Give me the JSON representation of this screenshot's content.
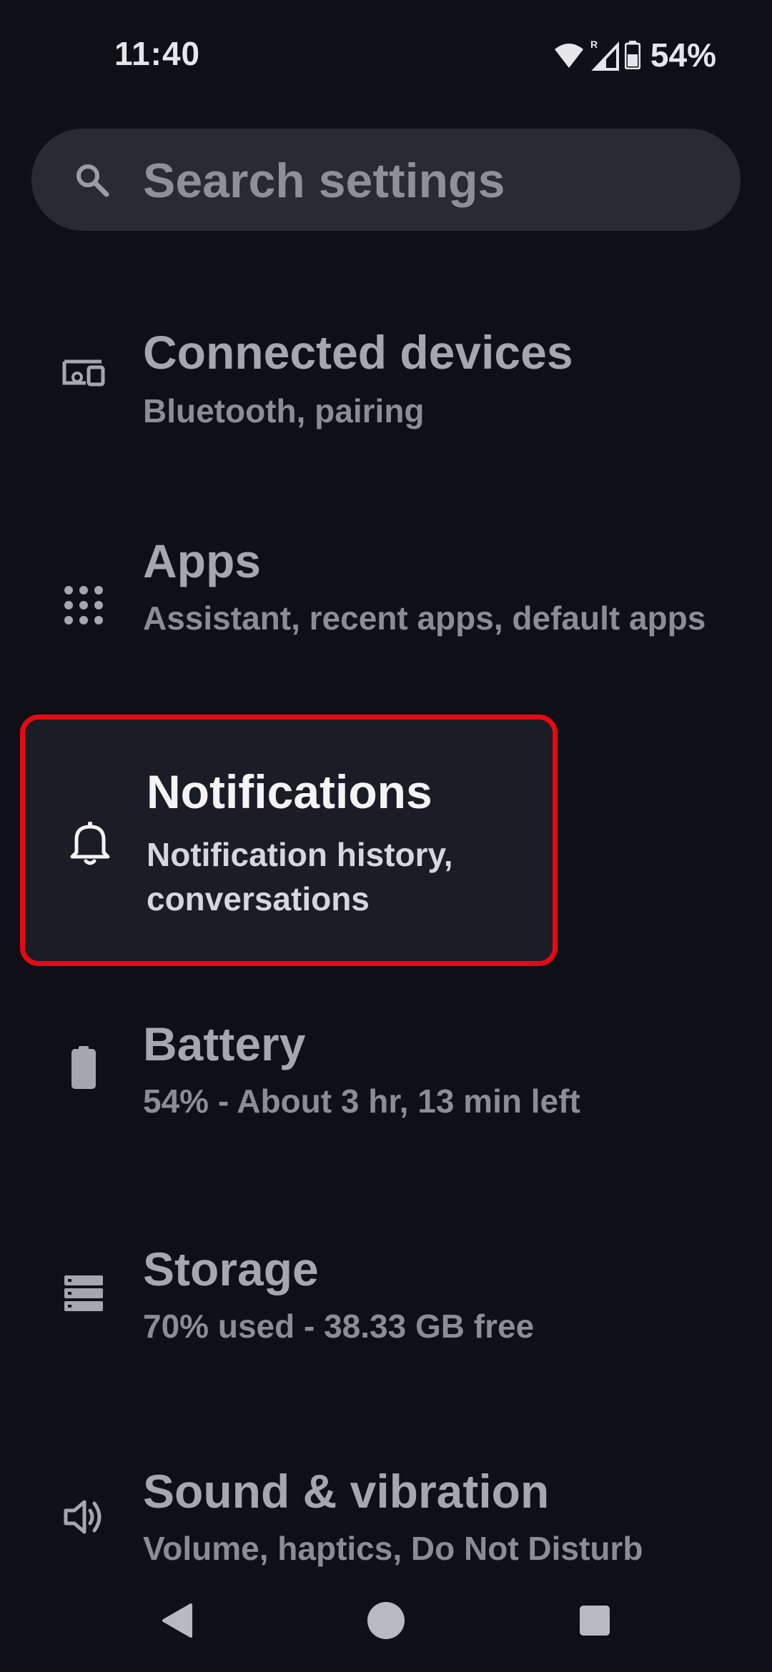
{
  "status_bar": {
    "time": "11:40",
    "battery_percent": "54%"
  },
  "search": {
    "placeholder": "Search settings"
  },
  "settings": {
    "items": [
      {
        "title": "Connected devices",
        "subtitle": "Bluetooth, pairing",
        "icon": "devices-icon"
      },
      {
        "title": "Apps",
        "subtitle": "Assistant, recent apps, default apps",
        "icon": "apps-grid-icon"
      },
      {
        "title": "Notifications",
        "subtitle": "Notification history, conversations",
        "icon": "bell-icon",
        "highlighted": true
      },
      {
        "title": "Battery",
        "subtitle": "54% - About 3 hr, 13 min left",
        "icon": "battery-icon"
      },
      {
        "title": "Storage",
        "subtitle": "70% used - 38.33 GB free",
        "icon": "storage-icon"
      },
      {
        "title": "Sound & vibration",
        "subtitle": "Volume, haptics, Do Not Disturb",
        "icon": "speaker-icon"
      }
    ]
  },
  "colors": {
    "background": "#0f1015",
    "search_background": "#2a2b30",
    "highlight_border": "#e50914",
    "highlight_background": "#1a1c26"
  }
}
